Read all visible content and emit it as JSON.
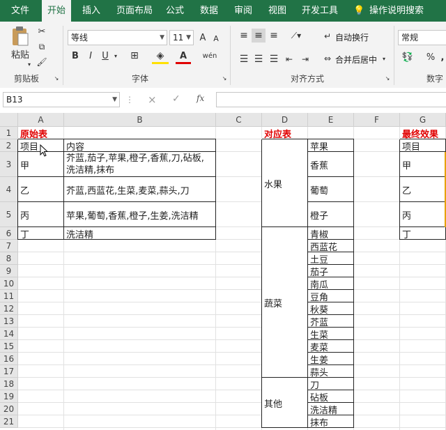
{
  "tabs": [
    "文件",
    "开始",
    "插入",
    "页面布局",
    "公式",
    "数据",
    "审阅",
    "视图",
    "开发工具"
  ],
  "tell_me": "操作说明搜索",
  "ribbon": {
    "paste_label": "粘贴",
    "clipboard_label": "剪贴板",
    "font_name": "等线",
    "font_size": "11",
    "font_label": "字体",
    "wrap_text": "自动换行",
    "merge_center": "合并后居中",
    "align_label": "对齐方式",
    "number_format": "常规",
    "number_label": "数字",
    "bold": "B",
    "italic": "I",
    "underline": "U",
    "font_grow": "A",
    "font_shrink": "A",
    "percent": "%",
    "comma": ",",
    "accent_color": "#217346"
  },
  "formula_bar": {
    "name_box": "B13",
    "fx": "fx",
    "cancel": "×",
    "enter": "✓",
    "formula": ""
  },
  "columns": [
    "A",
    "B",
    "C",
    "D",
    "E",
    "F",
    "G"
  ],
  "rows": [
    "1",
    "2",
    "3",
    "4",
    "5",
    "6",
    "7",
    "8",
    "9",
    "10",
    "11",
    "12",
    "13",
    "14",
    "15",
    "16",
    "17",
    "18",
    "19",
    "20",
    "21"
  ],
  "original": {
    "title": "原始表",
    "header": [
      "项目",
      "内容"
    ],
    "rows": [
      {
        "item": "甲",
        "content_line1": "芥蓝,茄子,苹果,橙子,香蕉,刀,砧板,",
        "content_line2": "洗洁精,抹布"
      },
      {
        "item": "乙",
        "content_line1": "芥蓝,西蓝花,生菜,麦菜,蒜头,刀",
        "content_line2": ""
      },
      {
        "item": "丙",
        "content_line1": "苹果,葡萄,香蕉,橙子,生姜,洗洁精",
        "content_line2": ""
      },
      {
        "item": "丁",
        "content_line1": "洗洁精",
        "content_line2": ""
      }
    ]
  },
  "mapping": {
    "title": "对应表",
    "categories": [
      "水果",
      "蔬菜",
      "其他"
    ],
    "items": [
      "苹果",
      "香蕉",
      "葡萄",
      "橙子",
      "青椒",
      "西蓝花",
      "土豆",
      "茄子",
      "南瓜",
      "豆角",
      "秋葵",
      "芥蓝",
      "生菜",
      "麦菜",
      "生姜",
      "蒜头",
      "刀",
      "砧板",
      "洗洁精",
      "抹布"
    ]
  },
  "result": {
    "title": "最终效果",
    "items": [
      "项目",
      "甲",
      "乙",
      "丙",
      "丁"
    ]
  }
}
